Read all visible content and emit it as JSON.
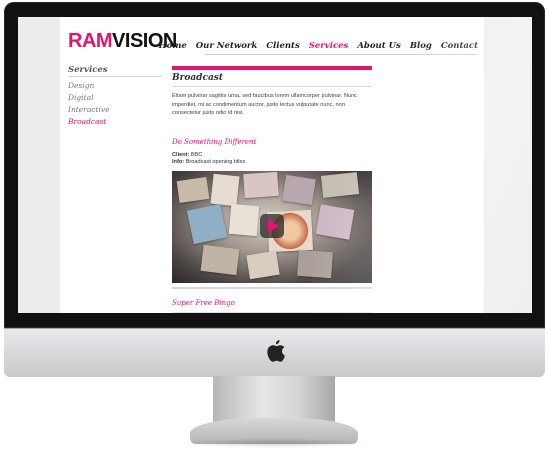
{
  "brand": {
    "logo_part1": "RAM",
    "logo_part2": "VISION",
    "accent": "#e3136e"
  },
  "nav": {
    "items": [
      "Home",
      "Our Network",
      "Clients",
      "Services",
      "About Us",
      "Blog",
      "Contact"
    ],
    "active": "Services"
  },
  "sidebar": {
    "title": "Services",
    "items": [
      "Design",
      "Digital",
      "Interactive",
      "Broadcast"
    ],
    "active": "Broadcast"
  },
  "main": {
    "title": "Broadcast",
    "intro": "Etiam pulvinar sagittis urna, sed faucibus lorem ullamcorper pulvinar. Nunc imperdiet, mi ac condimentum auctor, justo lectus vulputate nunc, non consectetur justo odio id nisi.",
    "project": {
      "title": "Do Something Different",
      "client_label": "Client:",
      "client_value": "BBC",
      "info_label": "Info:",
      "info_value": "Broadcast opening titles"
    },
    "next_project_title": "Super Free Bingo"
  },
  "icons": {
    "play": "play-icon",
    "apple": "apple-logo-icon"
  }
}
